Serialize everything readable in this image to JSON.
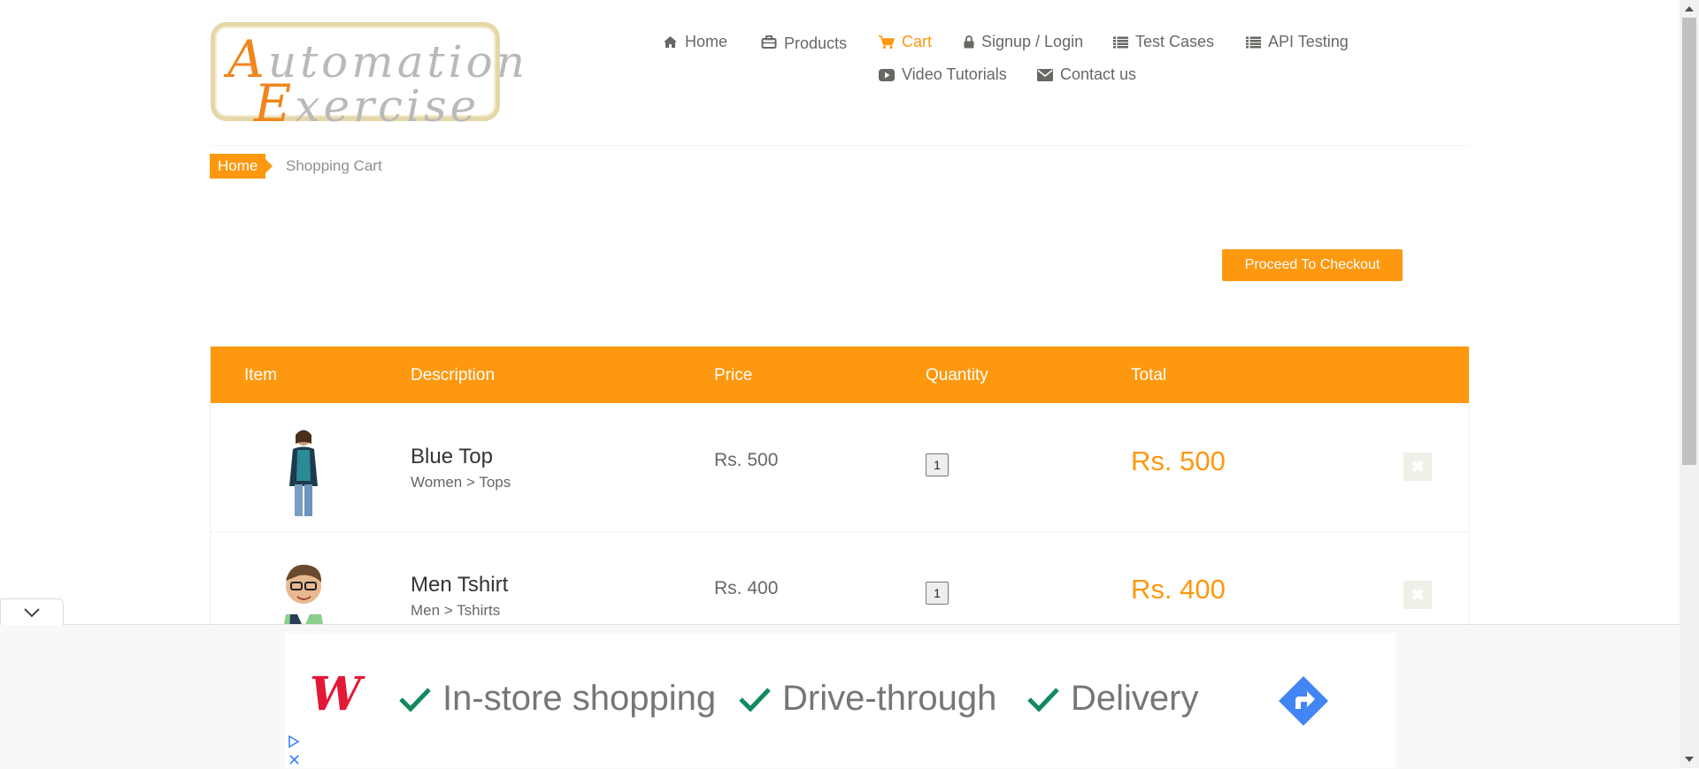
{
  "logo": {
    "line1_cap": "A",
    "line1_rest": "utomation",
    "line2_cap": "E",
    "line2_rest": "xercise"
  },
  "nav": {
    "items": [
      {
        "label": "Home",
        "icon": "home-icon"
      },
      {
        "label": "Products",
        "icon": "briefcase-icon"
      },
      {
        "label": "Cart",
        "icon": "shopping-cart-icon",
        "active": true
      },
      {
        "label": "Signup / Login",
        "icon": "lock-icon"
      },
      {
        "label": "Test Cases",
        "icon": "list-icon"
      },
      {
        "label": "API Testing",
        "icon": "list-icon"
      },
      {
        "label": "Video Tutorials",
        "icon": "youtube-play-icon"
      },
      {
        "label": "Contact us",
        "icon": "envelope-icon"
      }
    ]
  },
  "breadcrumb": {
    "home": "Home",
    "current": "Shopping Cart"
  },
  "checkout_button": "Proceed To Checkout",
  "cart": {
    "headers": [
      "Item",
      "Description",
      "Price",
      "Quantity",
      "Total"
    ],
    "rows": [
      {
        "name": "Blue Top",
        "category": "Women > Tops",
        "price": "Rs. 500",
        "quantity": "1",
        "total": "Rs. 500"
      },
      {
        "name": "Men Tshirt",
        "category": "Men > Tshirts",
        "price": "Rs. 400",
        "quantity": "1",
        "total": "Rs. 400"
      }
    ],
    "delete_glyph": "✖"
  },
  "ad": {
    "brand": "W",
    "features": [
      "In-store shopping",
      "Drive-through",
      "Delivery"
    ],
    "close_glyph": "✕"
  },
  "colors": {
    "accent": "#fe980f",
    "text": "#696763",
    "ad_brand": "#e31837",
    "ad_check": "#128a5c",
    "ad_arrow": "#4285f4"
  }
}
